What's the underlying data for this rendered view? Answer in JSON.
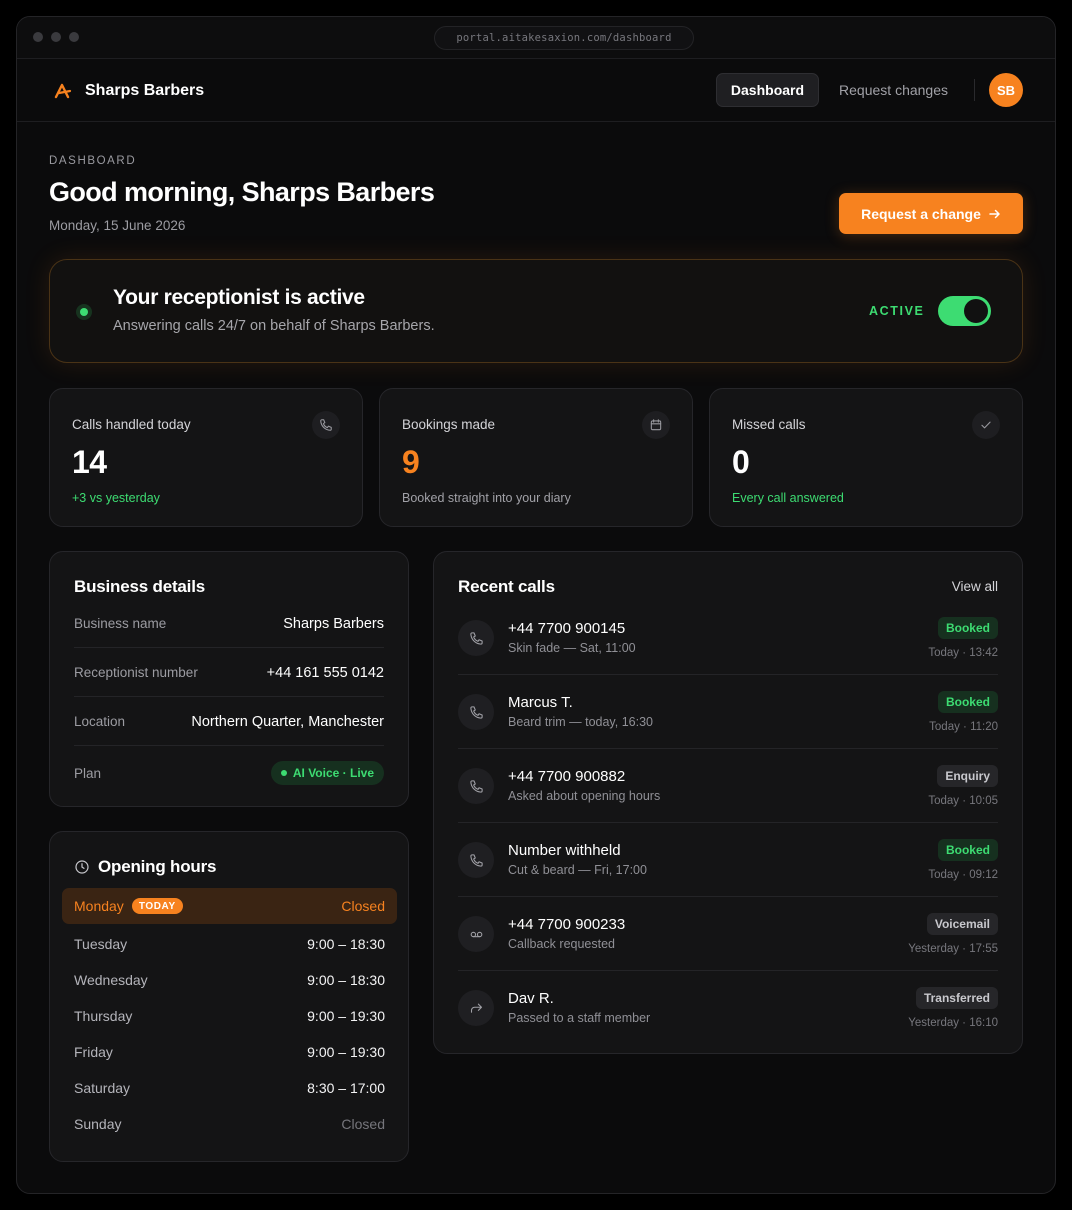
{
  "browser": {
    "url": "portal.aitakesaxion.com/dashboard"
  },
  "nav": {
    "brand": "Sharps Barbers",
    "items": [
      {
        "label": "Dashboard",
        "active": true
      },
      {
        "label": "Request changes",
        "active": false
      }
    ],
    "avatar_initials": "SB"
  },
  "header": {
    "eyebrow": "DASHBOARD",
    "greeting": "Good morning, Sharps Barbers",
    "date": "Monday, 15 June 2026",
    "cta_label": "Request a change"
  },
  "status": {
    "title": "Your receptionist is active",
    "subtitle": "Answering calls 24/7 on behalf of Sharps Barbers.",
    "state_label": "ACTIVE",
    "enabled": true
  },
  "stats": [
    {
      "label": "Calls handled today",
      "value": "14",
      "note": "+3 vs yesterday",
      "icon": "phone-icon"
    },
    {
      "label": "Bookings made",
      "value": "9",
      "note": "Booked straight into your diary",
      "icon": "calendar-icon"
    },
    {
      "label": "Missed calls",
      "value": "0",
      "note": "Every call answered",
      "icon": "check-icon"
    }
  ],
  "business": {
    "title": "Business details",
    "rows": [
      {
        "key": "Business name",
        "value": "Sharps Barbers"
      },
      {
        "key": "Receptionist number",
        "value": "+44 161 555 0142"
      },
      {
        "key": "Location",
        "value": "Northern Quarter, Manchester"
      },
      {
        "key": "Plan",
        "value": "AI Voice · Live"
      }
    ]
  },
  "hours": {
    "title": "Opening hours",
    "today_badge": "TODAY",
    "days": [
      {
        "day": "Monday",
        "time": "Closed",
        "today": true
      },
      {
        "day": "Tuesday",
        "time": "9:00 – 18:30"
      },
      {
        "day": "Wednesday",
        "time": "9:00 – 18:30"
      },
      {
        "day": "Thursday",
        "time": "9:00 – 19:30"
      },
      {
        "day": "Friday",
        "time": "9:00 – 19:30"
      },
      {
        "day": "Saturday",
        "time": "8:30 – 17:00"
      },
      {
        "day": "Sunday",
        "time": "Closed"
      }
    ]
  },
  "calls": {
    "title": "Recent calls",
    "view_all": "View all",
    "items": [
      {
        "name": "+44 7700 900145",
        "desc": "Skin fade — Sat, 11:00",
        "badge": "Booked",
        "time": "Today · 13:42",
        "icon": "phone-icon"
      },
      {
        "name": "Marcus T.",
        "desc": "Beard trim — today, 16:30",
        "badge": "Booked",
        "time": "Today · 11:20",
        "icon": "phone-icon"
      },
      {
        "name": "+44 7700 900882",
        "desc": "Asked about opening hours",
        "badge": "Enquiry",
        "time": "Today · 10:05",
        "icon": "phone-icon"
      },
      {
        "name": "Number withheld",
        "desc": "Cut & beard — Fri, 17:00",
        "badge": "Booked",
        "time": "Today · 09:12",
        "icon": "phone-icon"
      },
      {
        "name": "+44 7700 900233",
        "desc": "Callback requested",
        "badge": "Voicemail",
        "time": "Yesterday · 17:55",
        "icon": "voicemail-icon"
      },
      {
        "name": "Dav R.",
        "desc": "Passed to a staff member",
        "badge": "Transferred",
        "time": "Yesterday · 16:10",
        "icon": "forward-icon"
      }
    ]
  },
  "colors": {
    "accent": "#f7821f",
    "success": "#3ddc72",
    "background": "#0b0b0c",
    "card": "#141415"
  }
}
